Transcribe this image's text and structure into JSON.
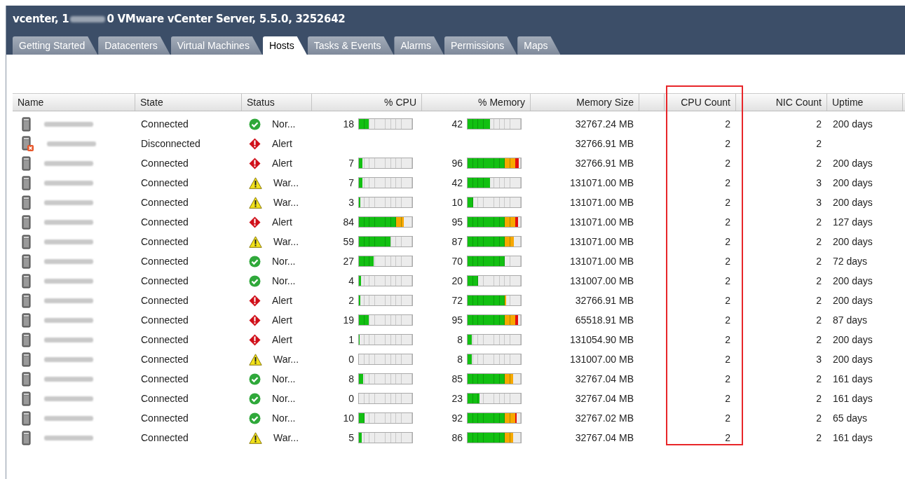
{
  "window": {
    "title_prefix": "vcenter, 1",
    "title_suffix": "0 VMware vCenter Server, 5.5.0, 3252642"
  },
  "tabs": [
    {
      "label": "Getting Started",
      "selected": false
    },
    {
      "label": "Datacenters",
      "selected": false
    },
    {
      "label": "Virtual Machines",
      "selected": false
    },
    {
      "label": "Hosts",
      "selected": true
    },
    {
      "label": "Tasks & Events",
      "selected": false
    },
    {
      "label": "Alarms",
      "selected": false
    },
    {
      "label": "Permissions",
      "selected": false
    },
    {
      "label": "Maps",
      "selected": false
    }
  ],
  "table": {
    "columns": [
      {
        "label": "Name",
        "highlighted": false
      },
      {
        "label": "State",
        "highlighted": false
      },
      {
        "label": "Status",
        "highlighted": false
      },
      {
        "label": "% CPU",
        "highlighted": false
      },
      {
        "label": "% Memory",
        "highlighted": false
      },
      {
        "label": "Memory Size",
        "highlighted": false
      },
      {
        "highlighted": false
      },
      {
        "label": "CPU Count",
        "highlighted": true
      },
      {
        "label": "NIC Count",
        "highlighted": false
      },
      {
        "label": "Uptime",
        "highlighted": false
      }
    ],
    "rows": [
      {
        "kind": "connected",
        "state": "Connected",
        "status": {
          "kind": "normal",
          "label": "Nor..."
        },
        "cpu": {
          "value": "18",
          "level": 0.18
        },
        "memory": {
          "value": "42",
          "level": 0.42
        },
        "memory_size": "32767.24 MB",
        "cpu_count": "2",
        "nic_count": "2",
        "uptime": "200 days"
      },
      {
        "kind": "disconnected",
        "state": "Disconnected",
        "status": {
          "kind": "alert",
          "label": "Alert"
        },
        "memory_size": "32766.91 MB",
        "cpu_count": "2",
        "nic_count": "2"
      },
      {
        "kind": "connected",
        "state": "Connected",
        "status": {
          "kind": "alert",
          "label": "Alert"
        },
        "cpu": {
          "value": "7",
          "level": 0.07
        },
        "memory": {
          "value": "96",
          "level": 0.96
        },
        "memory_size": "32766.91 MB",
        "cpu_count": "2",
        "nic_count": "2",
        "uptime": "200 days"
      },
      {
        "kind": "connected",
        "state": "Connected",
        "status": {
          "kind": "warning",
          "label": "War..."
        },
        "cpu": {
          "value": "7",
          "level": 0.07
        },
        "memory": {
          "value": "42",
          "level": 0.42
        },
        "memory_size": "131071.00 MB",
        "cpu_count": "2",
        "nic_count": "3",
        "uptime": "200 days"
      },
      {
        "kind": "connected",
        "state": "Connected",
        "status": {
          "kind": "warning",
          "label": "War..."
        },
        "cpu": {
          "value": "3",
          "level": 0.03
        },
        "memory": {
          "value": "10",
          "level": 0.1
        },
        "memory_size": "131071.00 MB",
        "cpu_count": "2",
        "nic_count": "3",
        "uptime": "200 days"
      },
      {
        "kind": "connected",
        "state": "Connected",
        "status": {
          "kind": "alert",
          "label": "Alert"
        },
        "cpu": {
          "value": "84",
          "level": 0.84
        },
        "memory": {
          "value": "95",
          "level": 0.95
        },
        "memory_size": "131071.00 MB",
        "cpu_count": "2",
        "nic_count": "2",
        "uptime": "127 days"
      },
      {
        "kind": "connected",
        "state": "Connected",
        "status": {
          "kind": "warning",
          "label": "War..."
        },
        "cpu": {
          "value": "59",
          "level": 0.59
        },
        "memory": {
          "value": "87",
          "level": 0.87
        },
        "memory_size": "131071.00 MB",
        "cpu_count": "2",
        "nic_count": "2",
        "uptime": "200 days"
      },
      {
        "kind": "connected",
        "state": "Connected",
        "status": {
          "kind": "normal",
          "label": "Nor..."
        },
        "cpu": {
          "value": "27",
          "level": 0.27
        },
        "memory": {
          "value": "70",
          "level": 0.7
        },
        "memory_size": "131071.00 MB",
        "cpu_count": "2",
        "nic_count": "2",
        "uptime": "72 days"
      },
      {
        "kind": "connected",
        "state": "Connected",
        "status": {
          "kind": "normal",
          "label": "Nor..."
        },
        "cpu": {
          "value": "4",
          "level": 0.04
        },
        "memory": {
          "value": "20",
          "level": 0.2
        },
        "memory_size": "131007.00 MB",
        "cpu_count": "2",
        "nic_count": "2",
        "uptime": "200 days"
      },
      {
        "kind": "connected",
        "state": "Connected",
        "status": {
          "kind": "alert",
          "label": "Alert"
        },
        "cpu": {
          "value": "2",
          "level": 0.02
        },
        "memory": {
          "value": "72",
          "level": 0.72
        },
        "memory_size": "32766.91 MB",
        "cpu_count": "2",
        "nic_count": "2",
        "uptime": "200 days"
      },
      {
        "kind": "connected",
        "state": "Connected",
        "status": {
          "kind": "alert",
          "label": "Alert"
        },
        "cpu": {
          "value": "19",
          "level": 0.19
        },
        "memory": {
          "value": "95",
          "level": 0.95
        },
        "memory_size": "65518.91 MB",
        "cpu_count": "2",
        "nic_count": "2",
        "uptime": "87 days"
      },
      {
        "kind": "connected",
        "state": "Connected",
        "status": {
          "kind": "alert",
          "label": "Alert"
        },
        "cpu": {
          "value": "1",
          "level": 0.01
        },
        "memory": {
          "value": "8",
          "level": 0.08
        },
        "memory_size": "131054.90 MB",
        "cpu_count": "2",
        "nic_count": "2",
        "uptime": "200 days"
      },
      {
        "kind": "connected",
        "state": "Connected",
        "status": {
          "kind": "warning",
          "label": "War..."
        },
        "cpu": {
          "value": "0"
        },
        "memory": {
          "value": "8",
          "level": 0.08
        },
        "memory_size": "131007.00 MB",
        "cpu_count": "2",
        "nic_count": "3",
        "uptime": "200 days"
      },
      {
        "kind": "connected",
        "state": "Connected",
        "status": {
          "kind": "normal",
          "label": "Nor..."
        },
        "cpu": {
          "value": "8",
          "level": 0.08
        },
        "memory": {
          "value": "85",
          "level": 0.85
        },
        "memory_size": "32767.04 MB",
        "cpu_count": "2",
        "nic_count": "2",
        "uptime": "161 days"
      },
      {
        "kind": "connected",
        "state": "Connected",
        "status": {
          "kind": "normal",
          "label": "Nor..."
        },
        "cpu": {
          "value": "0"
        },
        "memory": {
          "value": "23",
          "level": 0.23
        },
        "memory_size": "32767.04 MB",
        "cpu_count": "2",
        "nic_count": "2",
        "uptime": "161 days"
      },
      {
        "kind": "connected",
        "state": "Connected",
        "status": {
          "kind": "normal",
          "label": "Nor..."
        },
        "cpu": {
          "value": "10",
          "level": 0.1
        },
        "memory": {
          "value": "92",
          "level": 0.92
        },
        "memory_size": "32767.02 MB",
        "cpu_count": "2",
        "nic_count": "2",
        "uptime": "65 days"
      },
      {
        "kind": "connected",
        "state": "Connected",
        "status": {
          "kind": "warning",
          "label": "War..."
        },
        "cpu": {
          "value": "5",
          "level": 0.05
        },
        "memory": {
          "value": "86",
          "level": 0.86
        },
        "memory_size": "32767.04 MB",
        "cpu_count": "2",
        "nic_count": "2",
        "uptime": "161 days"
      }
    ]
  }
}
